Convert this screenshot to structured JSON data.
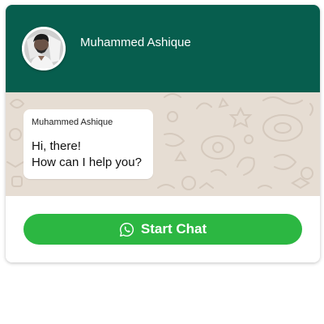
{
  "header": {
    "name": "Muhammed Ashique",
    "background_color": "#075e4e",
    "avatar_icon": "profile-photo"
  },
  "chat": {
    "background_color": "#e6ddd3",
    "message": {
      "sender": "Muhammed Ashique",
      "line1": "Hi, there!",
      "line2": "How can I help you?"
    }
  },
  "footer": {
    "button_label": "Start Chat",
    "button_color": "#2cb742",
    "button_icon": "whatsapp-icon"
  }
}
